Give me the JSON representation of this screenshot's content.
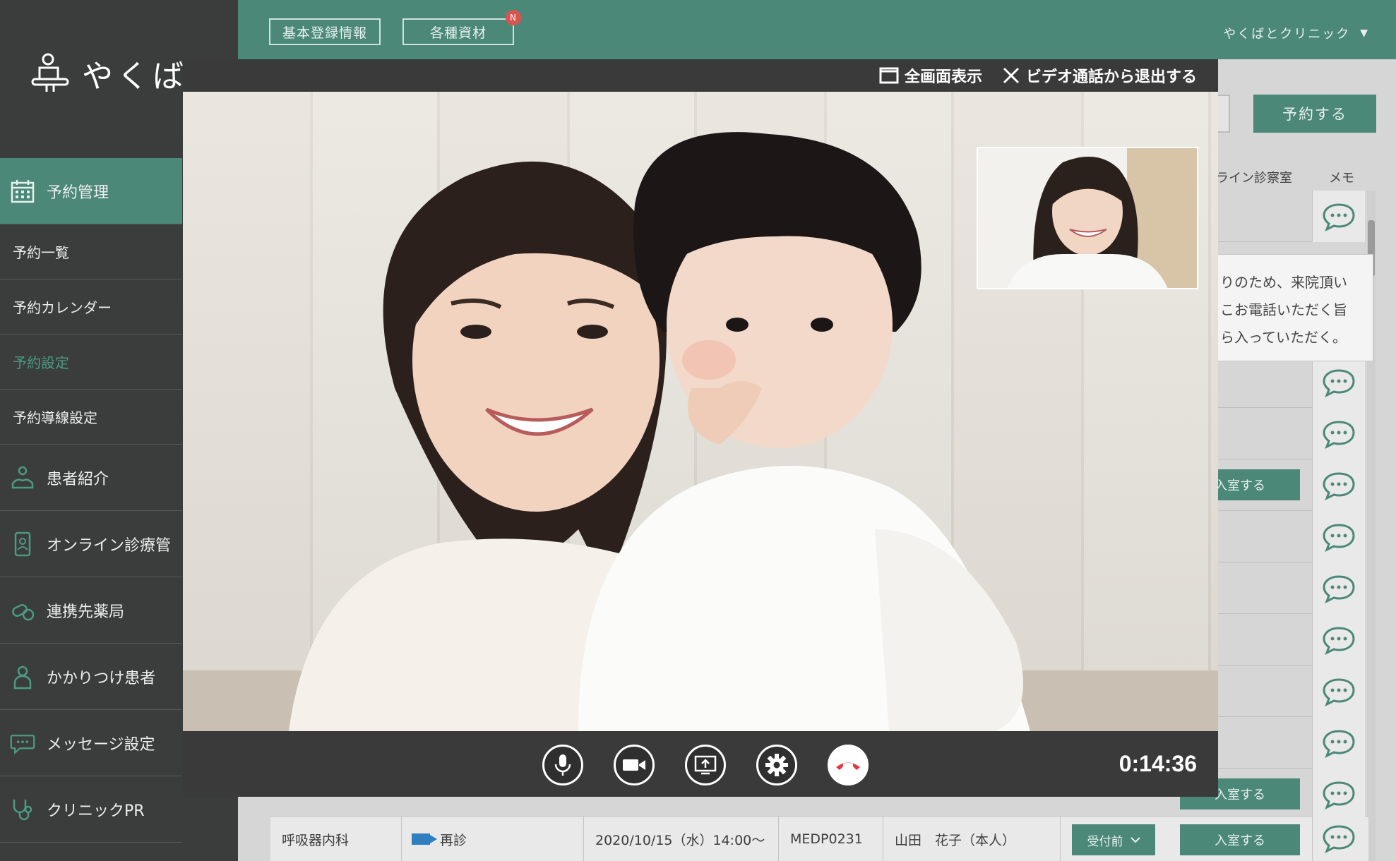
{
  "topbar": {
    "basic_info_label": "基本登録情報",
    "materials_label": "各種資材",
    "materials_badge": "N",
    "clinic_name": "やくばとクリニック",
    "dropdown_glyph": "▼"
  },
  "logo": {
    "text": "やくば"
  },
  "sidebar": {
    "reservation_mgmt": "予約管理",
    "reservation_list": "予約一覧",
    "reservation_calendar": "予約カレンダー",
    "reservation_settings": "予約設定",
    "reservation_flow": "予約導線設定",
    "patient_referral": "患者紹介",
    "online_clinic": "オンライン診療管",
    "partner_pharmacy": "連携先薬局",
    "regular_patients": "かかりつけ患者",
    "message_settings": "メッセージ設定",
    "clinic_pr": "クリニックPR"
  },
  "main": {
    "reserve_button": "予約する",
    "col_online_room": "ライン診察室",
    "col_memo": "メモ",
    "enter_room": "入室する",
    "memo_popover": [
      "りのため、来院頂い",
      "こお電話いただく旨",
      "ら入っていただく。"
    ]
  },
  "row": {
    "department": "呼吸器内科",
    "visit_type": "再診",
    "datetime": "2020/10/15（水）14:00〜",
    "patient_id": "MEDP0231",
    "patient_name": "山田　花子（本人）",
    "status": "受付前",
    "enter_room": "入室する"
  },
  "video": {
    "fullscreen_label": "全画面表示",
    "exit_label": "ビデオ通話から退出する",
    "timer": "0:14:36"
  },
  "colors": {
    "accent": "#4c8877",
    "sidebar": "#3b3d3d",
    "hangup": "#e0383e"
  }
}
